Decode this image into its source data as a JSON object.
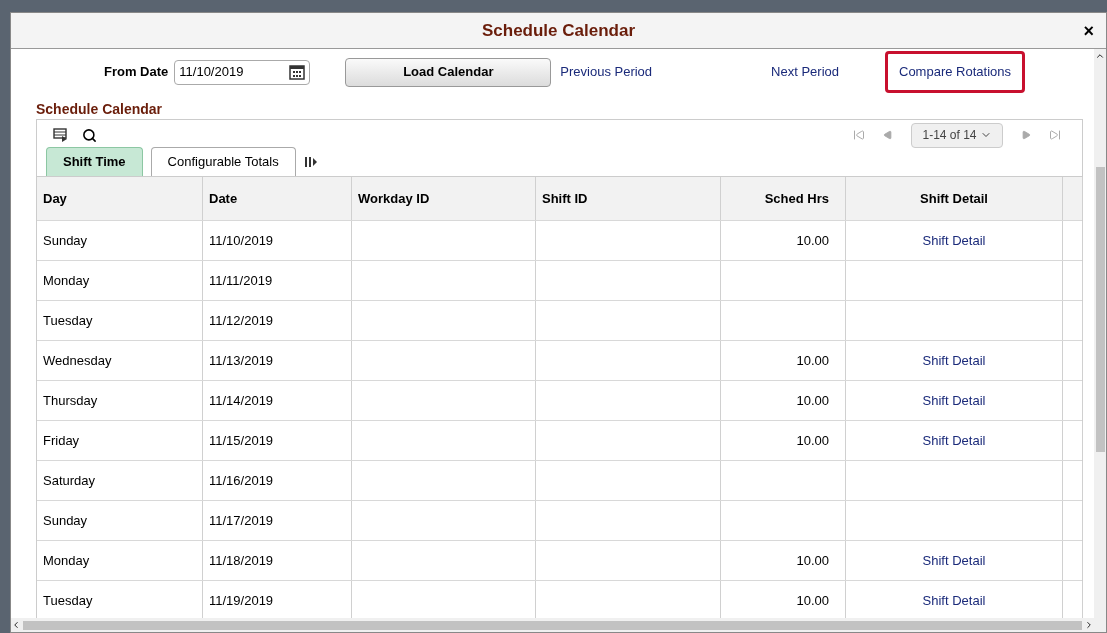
{
  "dialog": {
    "title": "Schedule Calendar",
    "close": "×"
  },
  "controls": {
    "from_date_label": "From Date",
    "from_date": "11/10/2019",
    "load_button": "Load Calendar",
    "links": [
      {
        "label": "Previous Period",
        "highlighted": false
      },
      {
        "label": "Next Period",
        "highlighted": false
      },
      {
        "label": "Compare Rotations",
        "highlighted": true
      }
    ]
  },
  "section_title": "Schedule Calendar",
  "pager": {
    "range": "1-14 of 14"
  },
  "tabs": [
    {
      "label": "Shift Time",
      "selected": true
    },
    {
      "label": "Configurable Totals",
      "selected": false
    }
  ],
  "table": {
    "columns": [
      "Day",
      "Date",
      "Workday ID",
      "Shift ID",
      "Sched Hrs",
      "Shift Detail"
    ],
    "rows": [
      {
        "day": "Sunday",
        "date": "11/10/2019",
        "sched_hrs": "10.00",
        "shift_detail": "Shift Detail"
      },
      {
        "day": "Monday",
        "date": "11/11/2019"
      },
      {
        "day": "Tuesday",
        "date": "11/12/2019"
      },
      {
        "day": "Wednesday",
        "date": "11/13/2019",
        "sched_hrs": "10.00",
        "shift_detail": "Shift Detail"
      },
      {
        "day": "Thursday",
        "date": "11/14/2019",
        "sched_hrs": "10.00",
        "shift_detail": "Shift Detail"
      },
      {
        "day": "Friday",
        "date": "11/15/2019",
        "sched_hrs": "10.00",
        "shift_detail": "Shift Detail"
      },
      {
        "day": "Saturday",
        "date": "11/16/2019"
      },
      {
        "day": "Sunday",
        "date": "11/17/2019"
      },
      {
        "day": "Monday",
        "date": "11/18/2019",
        "sched_hrs": "10.00",
        "shift_detail": "Shift Detail"
      },
      {
        "day": "Tuesday",
        "date": "11/19/2019",
        "sched_hrs": "10.00",
        "shift_detail": "Shift Detail"
      }
    ]
  }
}
